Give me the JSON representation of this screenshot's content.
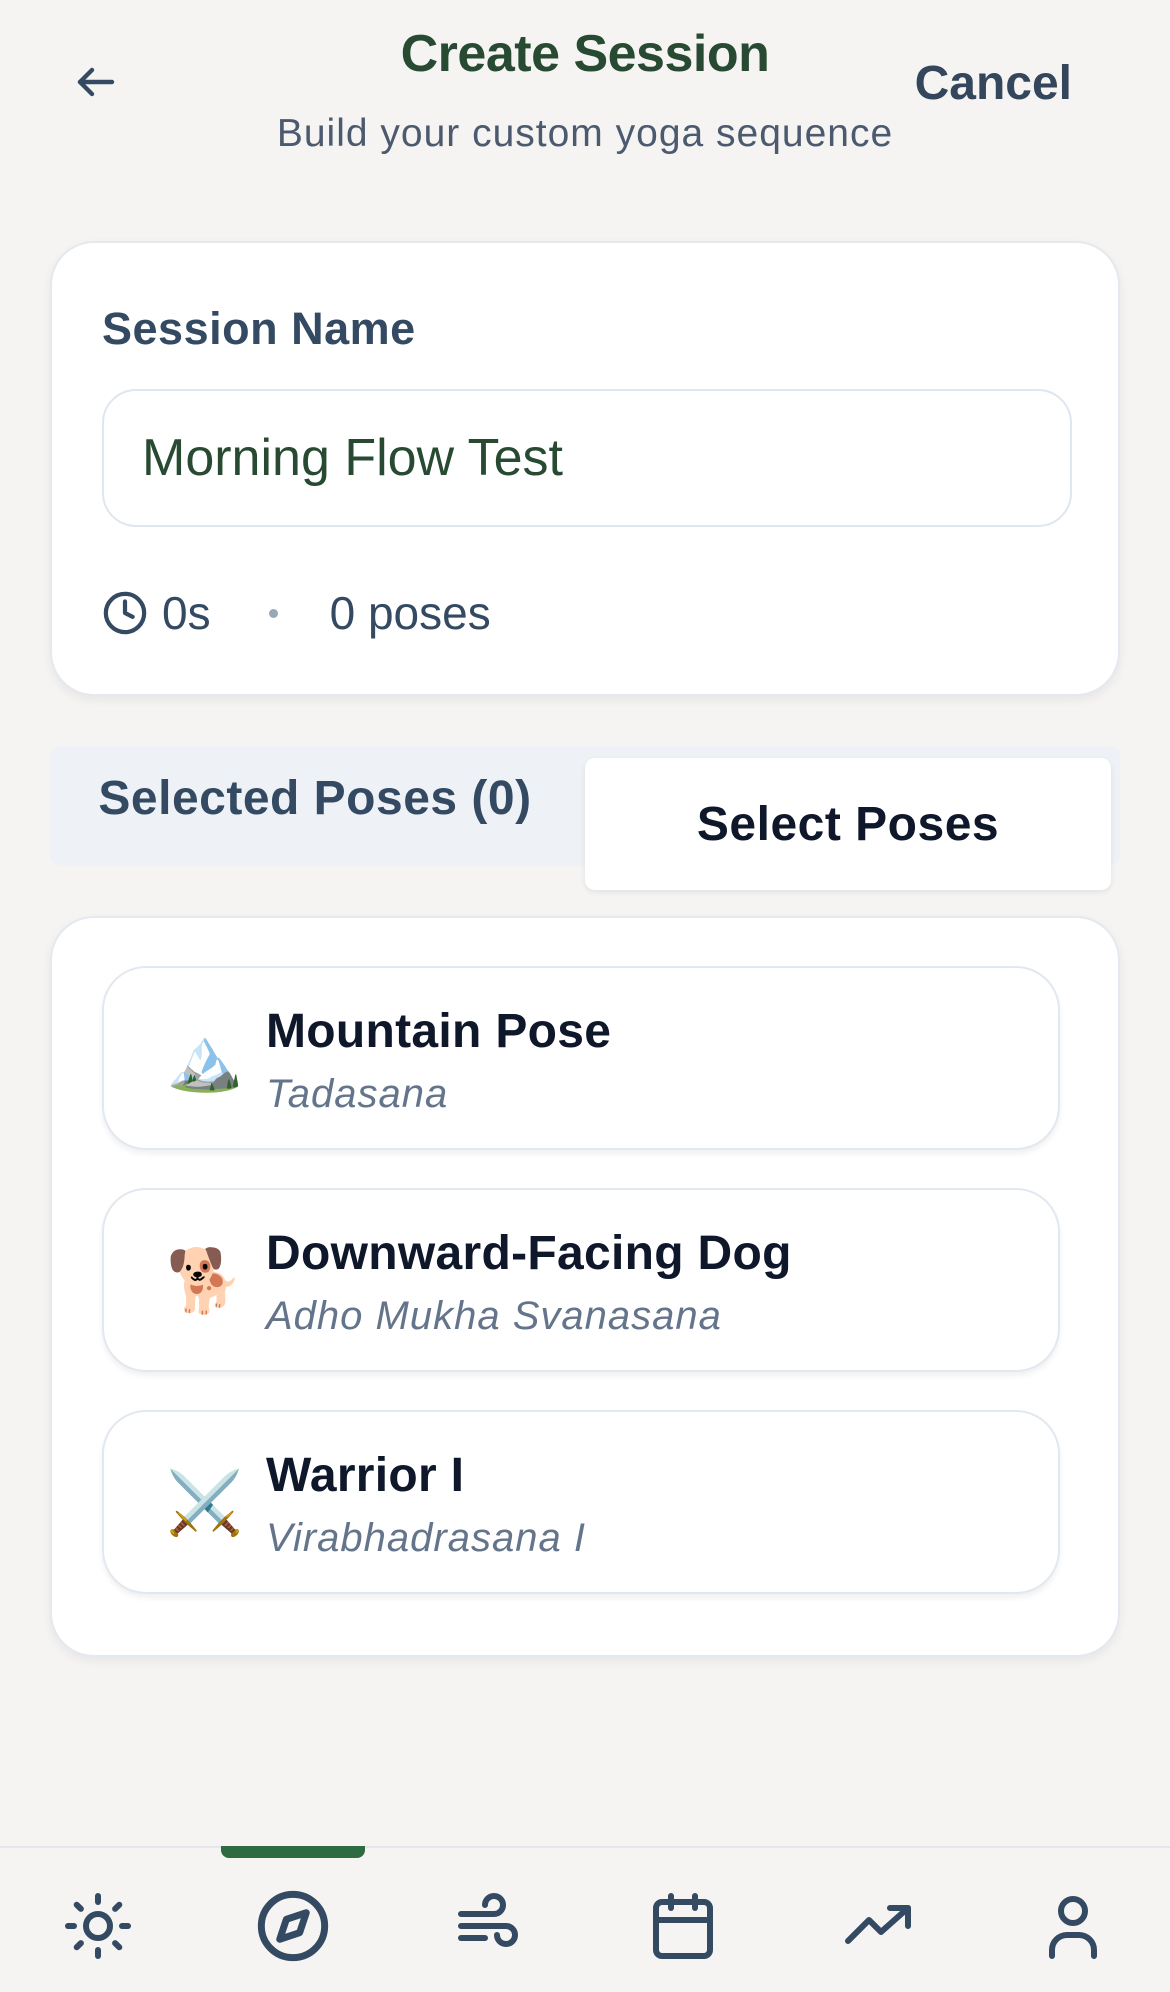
{
  "header": {
    "title": "Create Session",
    "subtitle": "Build your custom yoga sequence",
    "cancel_label": "Cancel",
    "back_icon": "arrow-left-icon"
  },
  "session": {
    "name_label": "Session Name",
    "name_value": "Morning Flow Test",
    "duration": "0s",
    "pose_count": "0 poses"
  },
  "tabs": [
    {
      "label": "Selected Poses (0)",
      "active": false
    },
    {
      "label": "Select Poses",
      "active": true
    }
  ],
  "poses": [
    {
      "emoji": "🏔️",
      "name": "Mountain Pose",
      "sanskrit": "Tadasana"
    },
    {
      "emoji": "🐕",
      "name": "Downward-Facing Dog",
      "sanskrit": "Adho Mukha Svanasana"
    },
    {
      "emoji": "⚔️",
      "name": "Warrior I",
      "sanskrit": "Virabhadrasana I"
    }
  ],
  "nav": [
    {
      "icon": "sun-icon",
      "active": false
    },
    {
      "icon": "compass-icon",
      "active": true
    },
    {
      "icon": "wind-icon",
      "active": false
    },
    {
      "icon": "calendar-icon",
      "active": false
    },
    {
      "icon": "trending-up-icon",
      "active": false
    },
    {
      "icon": "user-icon",
      "active": false
    }
  ],
  "colors": {
    "background": "#f5f4f2",
    "title": "#284a32",
    "accent": "#2f6b40",
    "text": "#334a62"
  }
}
